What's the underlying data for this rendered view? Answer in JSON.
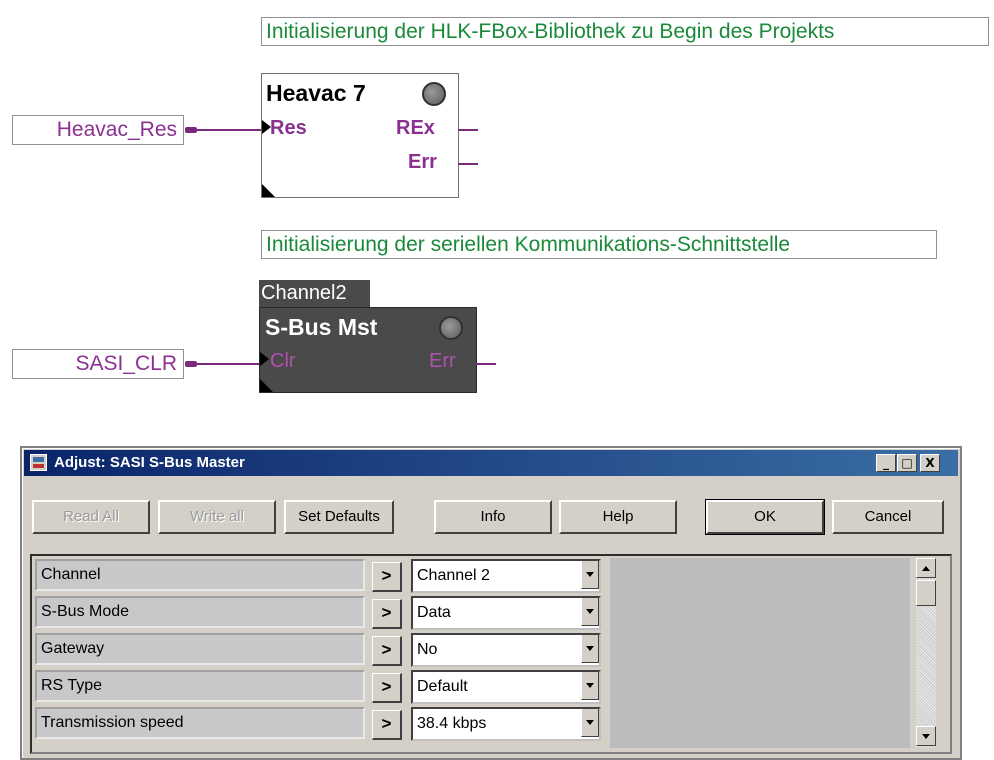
{
  "block1": {
    "comment": "Initialisierung der HLK-FBox-Bibliothek zu Begin des Projekts",
    "variable": "Heavac_Res",
    "fbox_title": "Heavac 7",
    "pin_in": "Res",
    "pin_out1": "REx",
    "pin_out2": "Err"
  },
  "block2": {
    "comment": "Initialisierung der seriellen Kommunikations-Schnittstelle",
    "variable": "SASI_CLR",
    "fbox_label": "Channel2",
    "fbox_title": "S-Bus Mst",
    "pin_in": "Clr",
    "pin_out": "Err"
  },
  "dialog": {
    "title": "Adjust: SASI S-Bus Master",
    "window_buttons": {
      "minimize": "_",
      "maximize": "□",
      "close": "X"
    },
    "buttons": {
      "read_all": "Read All",
      "write_all": "Write all",
      "set_defaults": "Set Defaults",
      "info": "Info",
      "help": "Help",
      "ok": "OK",
      "cancel": "Cancel"
    },
    "rows": [
      {
        "label": "Channel",
        "arrow": ">",
        "value": "Channel 2"
      },
      {
        "label": "S-Bus Mode",
        "arrow": ">",
        "value": "Data"
      },
      {
        "label": "Gateway",
        "arrow": ">",
        "value": "No"
      },
      {
        "label": "RS Type",
        "arrow": ">",
        "value": "Default"
      },
      {
        "label": "Transmission speed",
        "arrow": ">",
        "value": "38.4 kbps"
      }
    ]
  }
}
